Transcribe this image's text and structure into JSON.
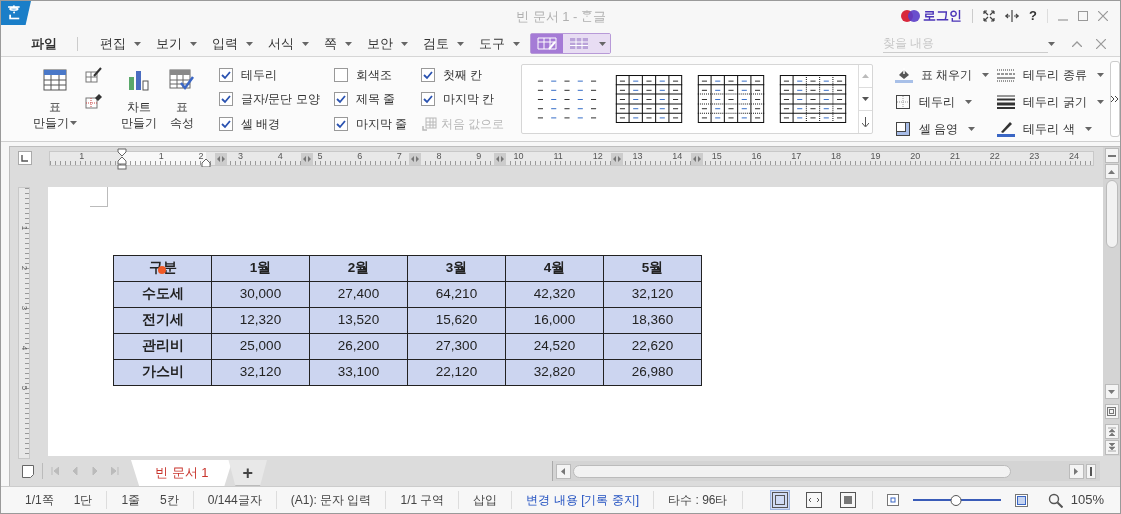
{
  "app": {
    "logo": "ᄒᆞᆫ",
    "title": "빈 문서 1 - ᄒᆞᆫ글",
    "login": "로그인",
    "help": "?"
  },
  "menu": [
    {
      "label": "파일",
      "dropdown": false
    },
    {
      "label": "편집",
      "dropdown": true
    },
    {
      "label": "보기",
      "dropdown": true
    },
    {
      "label": "입력",
      "dropdown": true
    },
    {
      "label": "서식",
      "dropdown": true
    },
    {
      "label": "쪽",
      "dropdown": true
    },
    {
      "label": "보안",
      "dropdown": true
    },
    {
      "label": "검토",
      "dropdown": true
    },
    {
      "label": "도구",
      "dropdown": true
    }
  ],
  "tool_tabs": [
    {
      "kind": "table-design",
      "selected": true
    },
    {
      "kind": "table-layout",
      "selected": false
    }
  ],
  "search": {
    "placeholder": "찾을 내용"
  },
  "ribbon": {
    "make_table": {
      "lines": [
        "표",
        "만들기"
      ],
      "dropdown": true
    },
    "chart": {
      "lines": [
        "차트",
        "만들기"
      ]
    },
    "properties": {
      "lines": [
        "표",
        "속성"
      ]
    },
    "checkboxes": [
      {
        "label": "테두리",
        "checked": true
      },
      {
        "label": "글자/문단 모양",
        "checked": true
      },
      {
        "label": "셀 배경",
        "checked": true
      },
      {
        "label": "회색조",
        "checked": false
      },
      {
        "label": "제목 줄",
        "checked": true
      },
      {
        "label": "마지막 줄",
        "checked": true
      },
      {
        "label": "첫째 칸",
        "checked": true
      },
      {
        "label": "마지막 칸",
        "checked": true
      }
    ],
    "reset": {
      "label": "처음 값으로",
      "disabled": true
    },
    "styles": [
      {
        "kind": "dashed"
      },
      {
        "kind": "grid"
      },
      {
        "kind": "dotted"
      },
      {
        "kind": "mixed"
      }
    ],
    "tools": [
      {
        "kind": "fill",
        "label": "표 채우기"
      },
      {
        "kind": "border",
        "label": "테두리"
      },
      {
        "kind": "shade",
        "label": "셀 음영"
      },
      {
        "kind": "border-type",
        "label": "테두리 종류"
      },
      {
        "kind": "border-weight",
        "label": "테두리 굵기"
      },
      {
        "kind": "border-color",
        "label": "테두리 색"
      }
    ]
  },
  "ruler": {
    "ticks": [
      "1",
      "1",
      "2",
      "3",
      "4",
      "5",
      "6",
      "7",
      "8",
      "9",
      "10",
      "11",
      "12",
      "13",
      "14",
      "15",
      "16",
      "17",
      "18",
      "19",
      "20",
      "21",
      "22",
      "23",
      "24"
    ]
  },
  "vertical_ruler": {
    "ticks": [
      "1",
      "2",
      "3",
      "4",
      "5"
    ]
  },
  "table": {
    "columns": [
      "구분",
      "1월",
      "2월",
      "3월",
      "4월",
      "5월"
    ],
    "rows": [
      {
        "label": "수도세",
        "values": [
          "30,000",
          "27,400",
          "64,210",
          "42,320",
          "32,120"
        ]
      },
      {
        "label": "전기세",
        "values": [
          "12,320",
          "13,520",
          "15,620",
          "16,000",
          "18,360"
        ]
      },
      {
        "label": "관리비",
        "values": [
          "25,000",
          "26,200",
          "27,300",
          "24,520",
          "22,620"
        ]
      },
      {
        "label": "가스비",
        "values": [
          "32,120",
          "33,100",
          "22,120",
          "32,820",
          "26,980"
        ]
      }
    ]
  },
  "doc_tabs": [
    {
      "label": "빈 문서 1",
      "selected": true
    }
  ],
  "new_tab": "+",
  "status_bar": {
    "groups": [
      {
        "items": [
          {
            "kind": "text",
            "text": "1/1쪽"
          },
          {
            "kind": "text",
            "text": "1단"
          }
        ]
      },
      {
        "items": [
          {
            "kind": "text",
            "text": "1줄"
          },
          {
            "kind": "text",
            "text": "5칸"
          }
        ]
      },
      {
        "items": [
          {
            "kind": "text",
            "text": "0/144글자"
          }
        ]
      },
      {
        "items": [
          {
            "kind": "text",
            "text": "(A1): 문자 입력"
          }
        ]
      },
      {
        "items": [
          {
            "kind": "text",
            "text": "1/1 구역"
          }
        ]
      },
      {
        "items": [
          {
            "kind": "text",
            "text": "삽입"
          }
        ]
      },
      {
        "items": [
          {
            "kind": "link",
            "text": "변경 내용 [기록 중지]"
          }
        ]
      },
      {
        "items": [
          {
            "kind": "text",
            "text": "타수 : 96타"
          }
        ]
      }
    ],
    "view_modes": [
      {
        "kind": "page",
        "selected": true
      },
      {
        "kind": "width",
        "selected": false
      },
      {
        "kind": "full",
        "selected": false
      }
    ],
    "zoom": {
      "level": 0.49,
      "reading": "105%"
    }
  }
}
